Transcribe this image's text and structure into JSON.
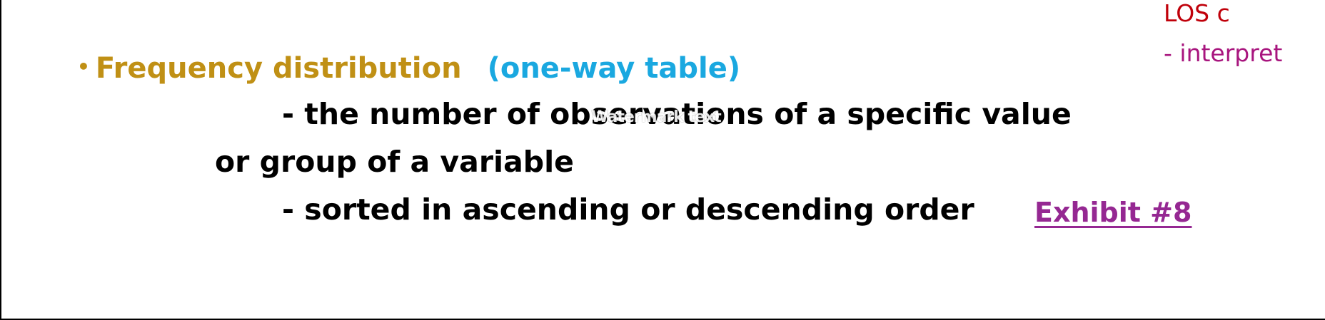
{
  "colors": {
    "heading": "#c09015",
    "subheading": "#1aa8e0",
    "body": "#000000",
    "exhibit": "#952892",
    "los": "#c0000a",
    "interpret": "#a8157e"
  },
  "heading": {
    "bullet": "•",
    "title": "Frequency distribution",
    "subtitle": "(one-way table)"
  },
  "body": {
    "line1": "- the number of observations of a specific value",
    "line2": "or group of a variable",
    "line3": "- sorted in ascending or descending order"
  },
  "watermark": "Watermark text",
  "exhibit": "Exhibit #8",
  "los": {
    "label": "LOS c",
    "action": "- interpret"
  }
}
